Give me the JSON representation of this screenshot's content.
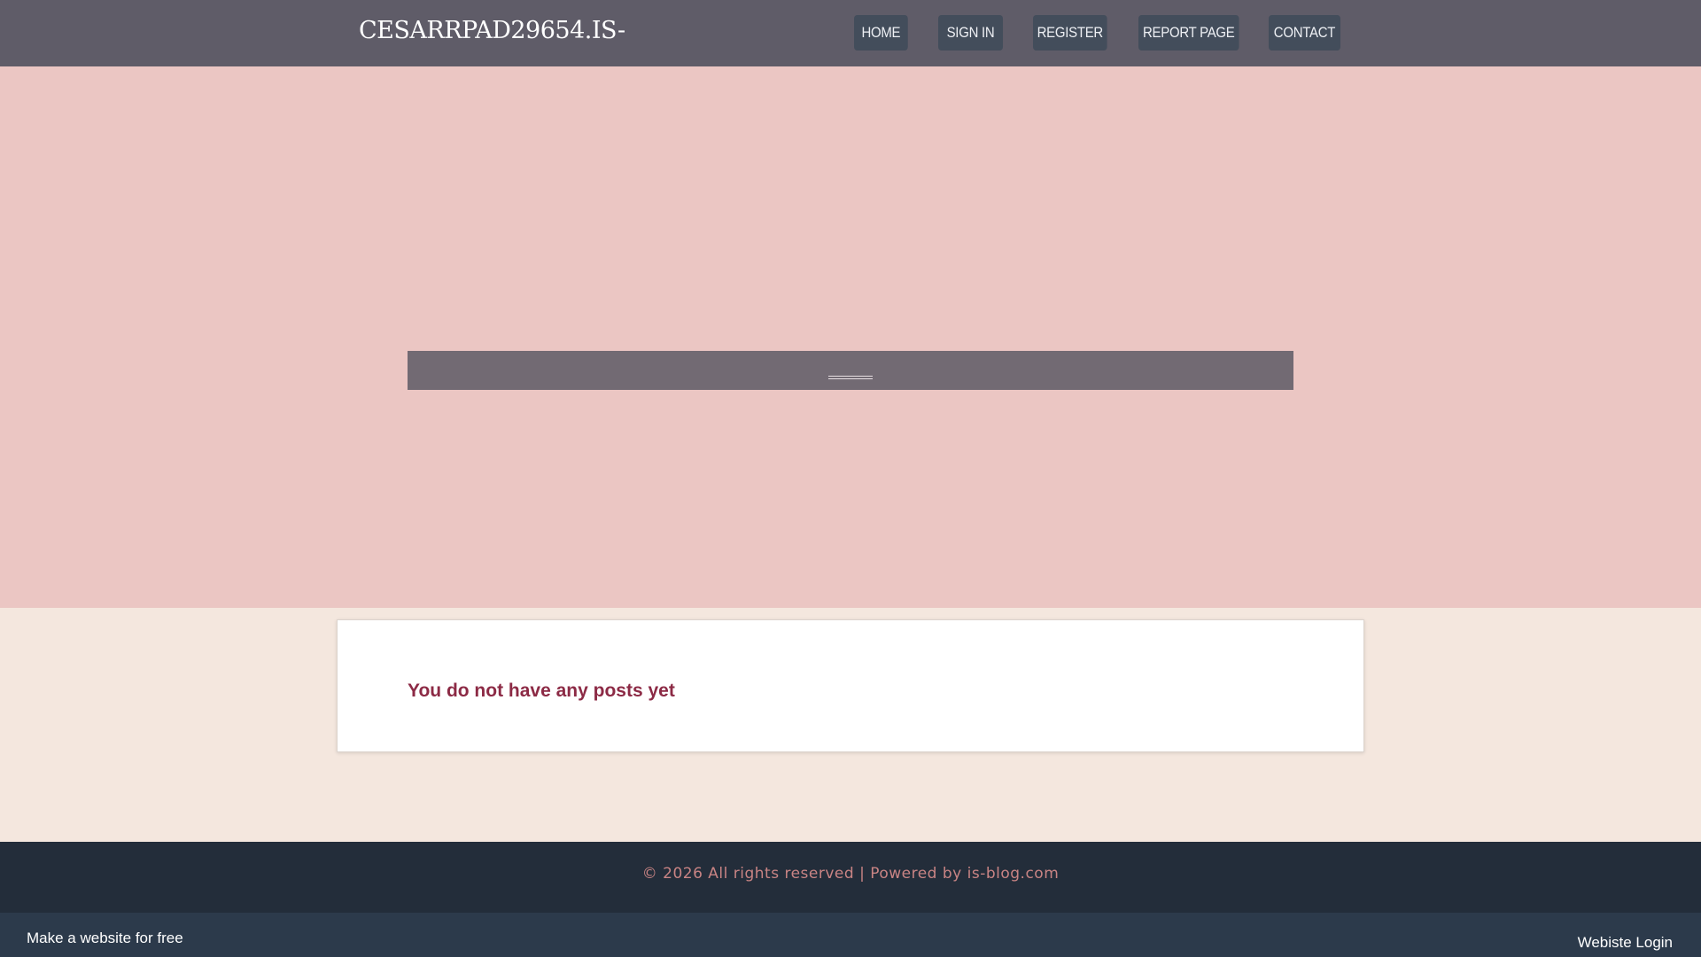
{
  "header": {
    "site_title": "CESARRPAD29654.IS-",
    "nav": {
      "home": "HOME",
      "sign_in": "SIGN IN",
      "register": "REGISTER",
      "report_page": "REPORT PAGE",
      "contact": "CONTACT"
    }
  },
  "main": {
    "empty_message": "You do not have any posts yet"
  },
  "footer": {
    "copyright": "© 2026 All rights reserved | Powered by is-blog.com"
  },
  "bottom_bar": {
    "make_website": "Make a website for free",
    "website_login": "Webiste Login"
  },
  "colors": {
    "header_bg": "#5f5c68",
    "nav_button_bg": "#434d5b",
    "hero_bg": "#ebc6c3",
    "hero_bar": "#726a73",
    "content_bg": "#f4e7de",
    "empty_message_text": "#8c2a45",
    "footer_bg": "#232d3a",
    "footer_text": "#c98484",
    "bottom_bar_bg": "#2c3a4b"
  }
}
